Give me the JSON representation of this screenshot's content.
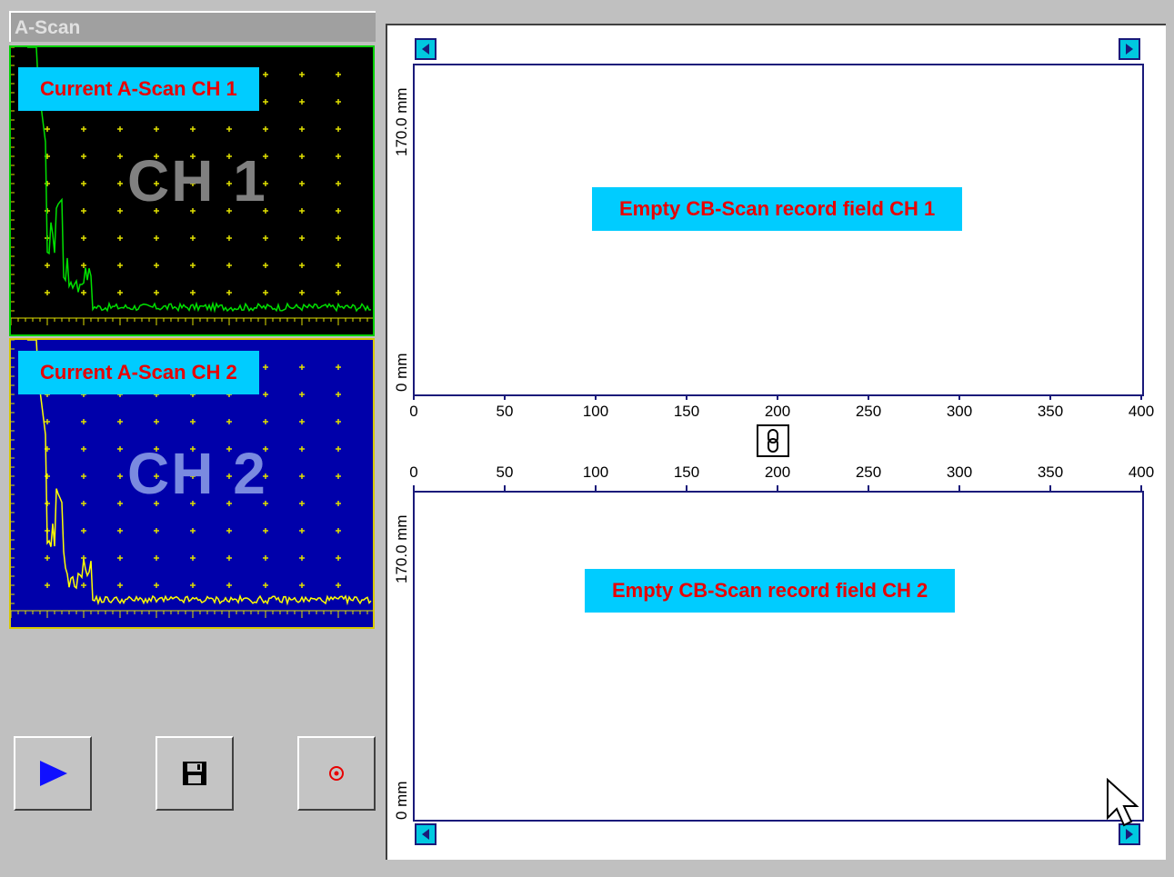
{
  "ascan_panel": {
    "title": "A-Scan",
    "channel1": {
      "label": "Current A-Scan CH 1",
      "watermark": "CH 1",
      "trace_color": "#00e000",
      "grid_color": "#e0e000"
    },
    "channel2": {
      "label": "Current A-Scan CH 2",
      "watermark": "CH 2",
      "trace_color": "#ffff00",
      "grid_color": "#e0e000"
    }
  },
  "controls": {
    "play_icon": "play-icon",
    "save_icon": "floppy-disk-icon",
    "record_icon": "record-icon"
  },
  "cbscan": {
    "field1": {
      "label": "Empty CB-Scan record field CH 1",
      "y_top": "170.0 mm",
      "y_bottom": "0 mm",
      "x_ticks": [
        "0",
        "50",
        "100",
        "150",
        "200",
        "250",
        "300",
        "350",
        "400"
      ]
    },
    "field2": {
      "label": "Empty CB-Scan record field CH 2",
      "y_top": "170.0 mm",
      "y_bottom": "0 mm",
      "x_ticks": [
        "0",
        "50",
        "100",
        "150",
        "200",
        "250",
        "300",
        "350",
        "400"
      ]
    },
    "link_icon": "chain-link-icon"
  },
  "colors": {
    "label_bg": "#00ccff",
    "label_text": "#e80000",
    "frame": "#1a1a7a",
    "scroll_button": "#00c8e0"
  }
}
